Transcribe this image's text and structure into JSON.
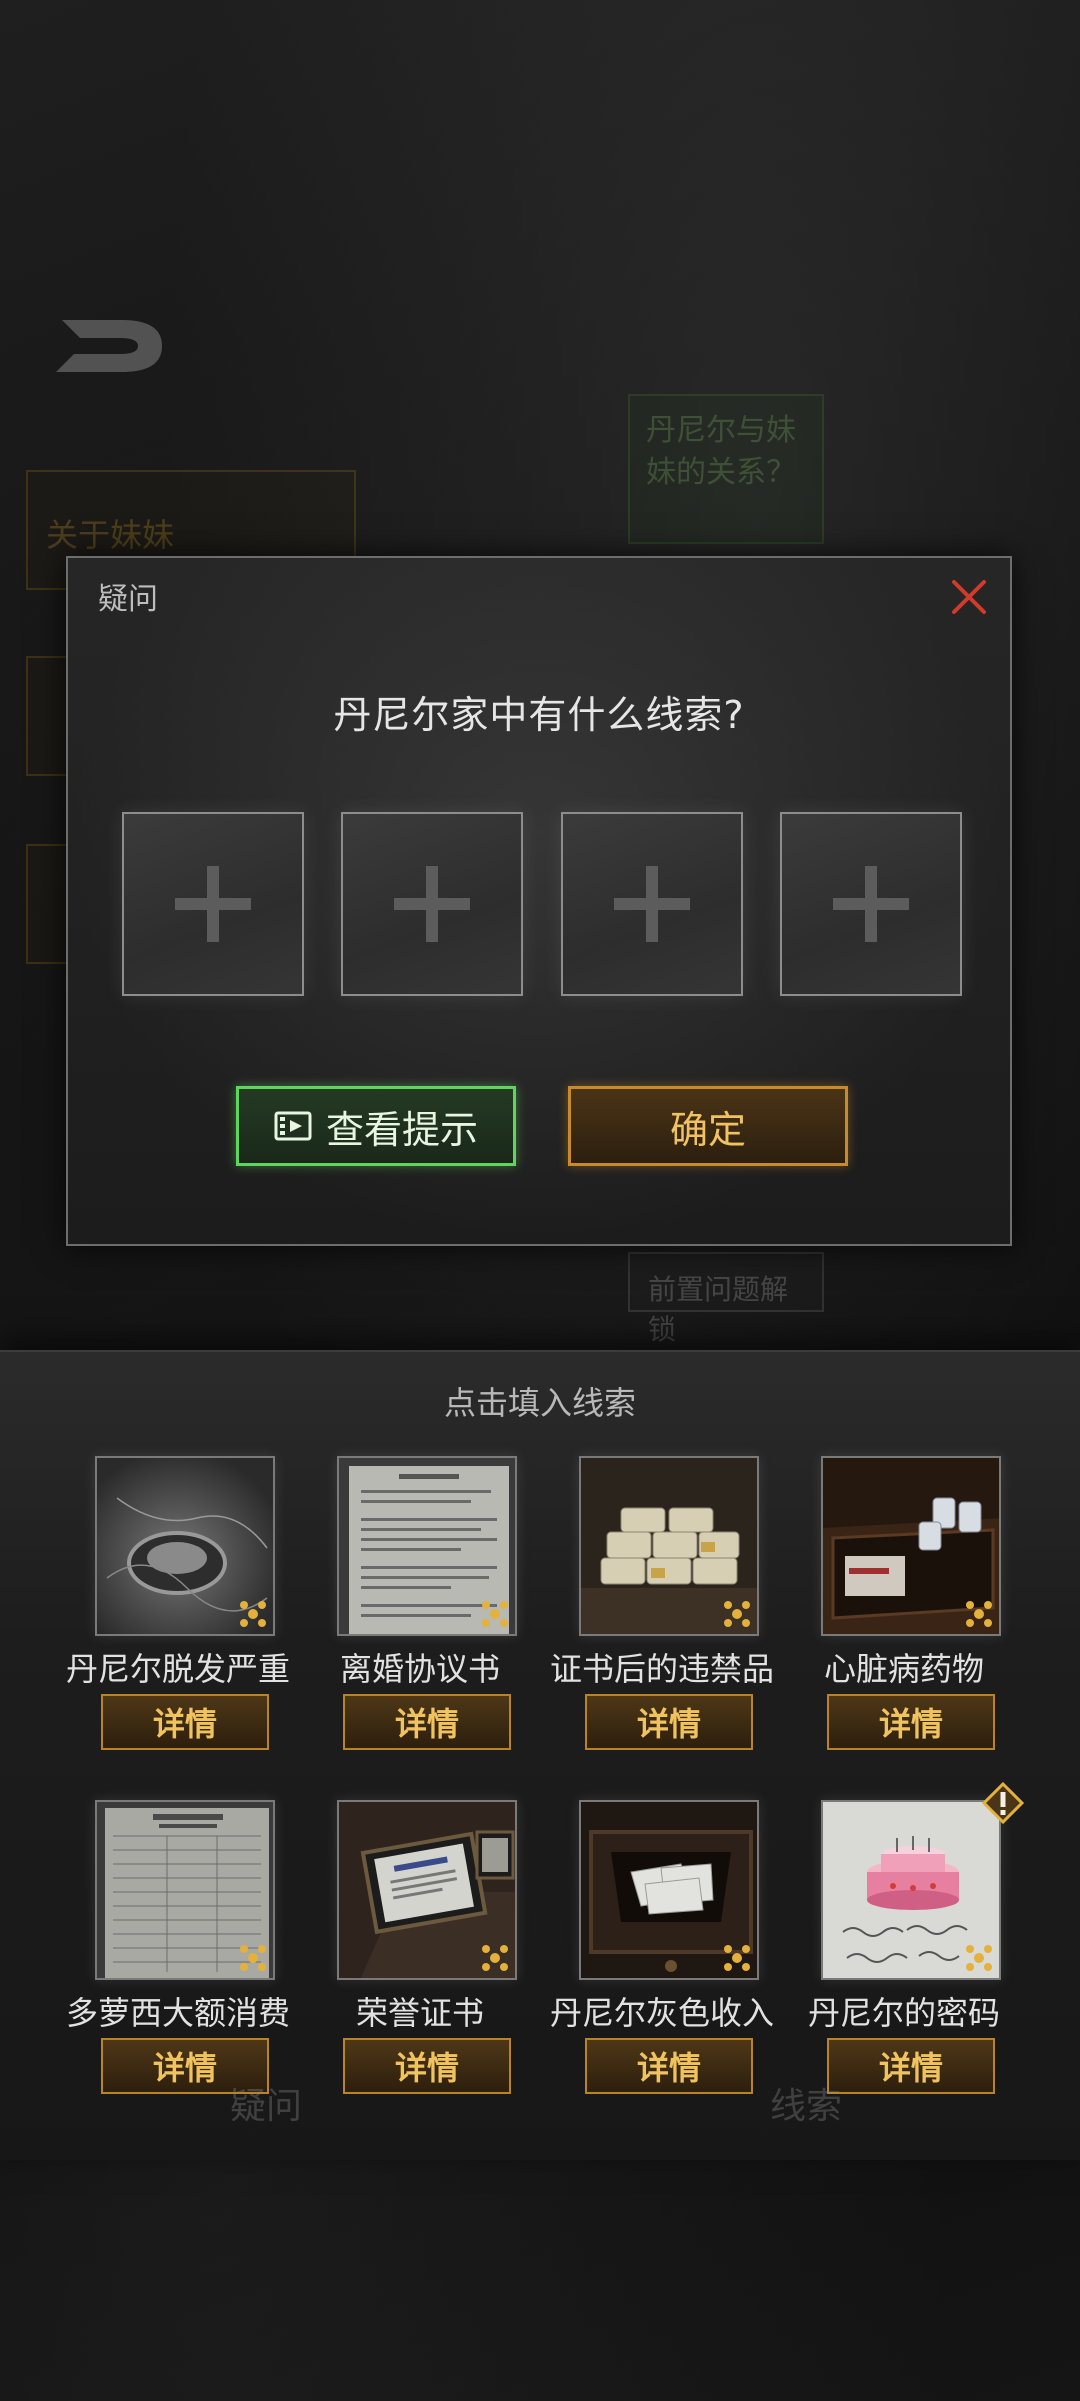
{
  "background": {
    "cards": [
      {
        "label": "关于妹妹",
        "tone": "gold"
      },
      {
        "label": "丹尼尔与妹妹的关系？",
        "tone": "green"
      },
      {
        "label": "前置问题解锁",
        "tone": "gray"
      }
    ],
    "tabs": [
      {
        "label": "疑问"
      },
      {
        "label": "线索"
      }
    ]
  },
  "dialog": {
    "title": "疑问",
    "question": "丹尼尔家中有什么线索?",
    "slots": [
      "plus-icon",
      "plus-icon",
      "plus-icon",
      "plus-icon"
    ],
    "hint_label": "查看提示",
    "confirm_label": "确定"
  },
  "panel": {
    "title": "点击填入线索",
    "detail_label": "详情",
    "clues": [
      {
        "name": "丹尼尔脱发严重",
        "thumb": "drain"
      },
      {
        "name": "离婚协议书",
        "thumb": "document"
      },
      {
        "name": "证书后的违禁品",
        "thumb": "packages"
      },
      {
        "name": "心脏病药物",
        "thumb": "medicine-drawer"
      },
      {
        "name": "多萝西大额消费",
        "thumb": "receipt"
      },
      {
        "name": "荣誉证书",
        "thumb": "certificate"
      },
      {
        "name": "丹尼尔灰色收入",
        "thumb": "envelope-drawer"
      },
      {
        "name": "丹尼尔的密码",
        "thumb": "birthday-cake",
        "new": true
      }
    ]
  },
  "colors": {
    "hint_border": "#5fd45f",
    "confirm_border": "#c98a2a",
    "close_icon": "#d23a2a",
    "badge": "#e3b13c"
  }
}
